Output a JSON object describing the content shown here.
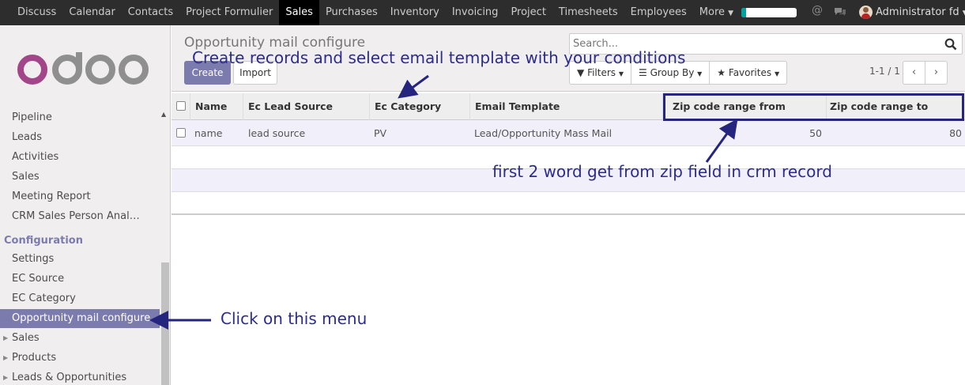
{
  "topbar": {
    "menu": [
      "Discuss",
      "Calendar",
      "Contacts",
      "Project Formulier",
      "Sales",
      "Purchases",
      "Inventory",
      "Invoicing",
      "Project",
      "Timesheets",
      "Employees",
      "More"
    ],
    "active": "Sales",
    "progress": 0.08,
    "user": "Administrator fd"
  },
  "logo_text": "odoo",
  "sidebar": {
    "items": [
      "Pipeline",
      "Leads",
      "Activities",
      "Sales",
      "Meeting Report",
      "CRM Sales Person Anal…"
    ],
    "section": "Configuration",
    "config_items": [
      "Settings",
      "EC Source",
      "EC Category",
      "Opportunity mail configure"
    ],
    "selected": "Opportunity mail configure",
    "collapsed": [
      "Sales",
      "Products",
      "Leads & Opportunities"
    ]
  },
  "control": {
    "title": "Opportunity mail configure",
    "create": "Create",
    "import": "Import",
    "search_placeholder": "Search...",
    "filters": "Filters",
    "group_by": "Group By",
    "favorites": "Favorites",
    "pager": "1-1 / 1"
  },
  "table": {
    "columns": [
      "Name",
      "Ec Lead Source",
      "Ec Category",
      "Email Template",
      "Zip code range from",
      "Zip code range to"
    ],
    "rows": [
      [
        "name",
        "lead source",
        "PV",
        "Lead/Opportunity Mass Mail",
        "50",
        "80"
      ]
    ]
  },
  "annotations": {
    "top": "Create records and select email template with your conditions",
    "zip": "first 2 word get from zip field in crm record",
    "menu": "Click on this menu"
  },
  "colors": {
    "accent": "#7c7bad",
    "annotation": "#2c2c8c",
    "topbar": "#2d2d2d"
  }
}
